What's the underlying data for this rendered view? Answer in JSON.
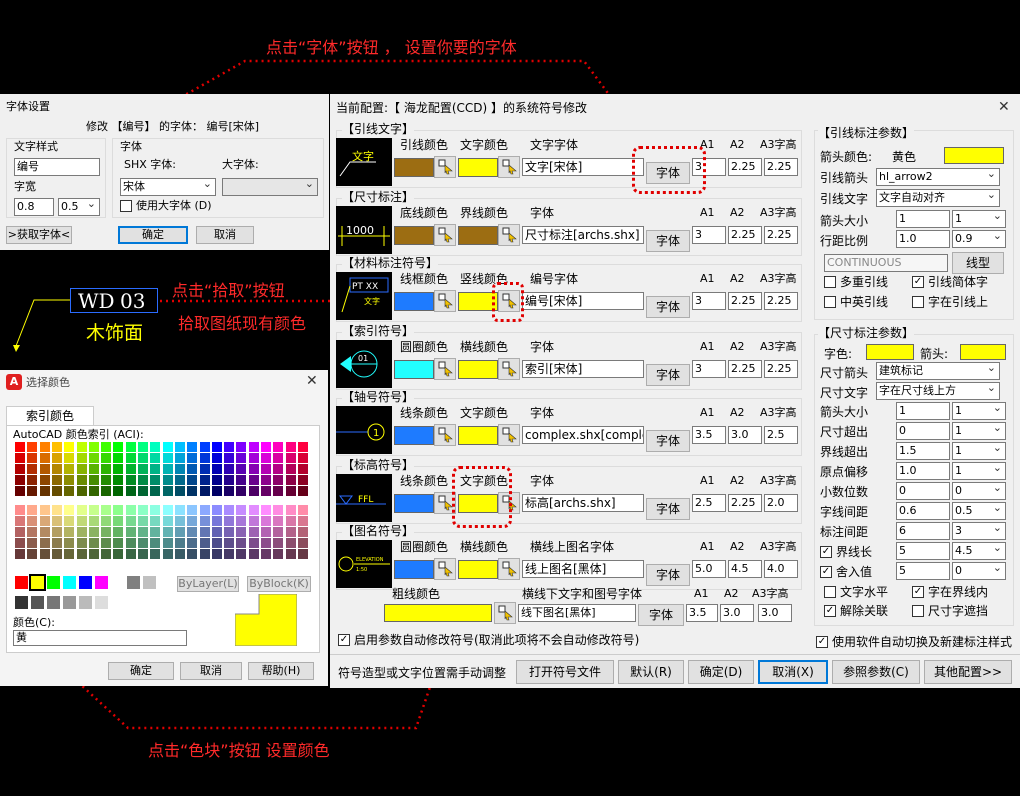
{
  "annotations": {
    "top": "点击“字体”按钮 ， 设置你要的字体",
    "pick1": "点击“拾取”按钮",
    "pick2": "拾取图纸现有颜色",
    "bottom": "点击“色块”按钮 设置颜色"
  },
  "sample": {
    "code": "WD",
    "num": "03",
    "text": "木饰面"
  },
  "font_dialog": {
    "title": "字体设置",
    "subtitle": "修改 【编号】 的字体： 编号[宋体]",
    "group_style": "文字样式",
    "style_value": "编号",
    "width_label": "字宽",
    "width_value": "0.8",
    "width_select": "0.5",
    "group_font": "字体",
    "shx_label": "SHX 字体:",
    "big_label": "大字体:",
    "shx_value": "宋体",
    "big_value": "",
    "use_big": "使用大字体 (D)",
    "get_font": ">获取字体<",
    "ok": "确定",
    "cancel": "取消"
  },
  "color_dialog": {
    "title": "选择颜色",
    "tab": "索引颜色",
    "aci_label": "AutoCAD 颜色索引 (ACI):",
    "bylayer": "ByLayer(L)",
    "byblock": "ByBlock(K)",
    "color_label": "颜色(C):",
    "color_value": "黄",
    "ok": "确定",
    "cancel": "取消",
    "help": "帮助(H)"
  },
  "main": {
    "title": "当前配置:【 海龙配置(CCD) 】的系统符号修改",
    "sections": [
      {
        "title": "【引线文字】",
        "c1": "引线颜色",
        "c2": "文字颜色",
        "fl": "文字字体",
        "font": "文字[宋体]",
        "a1": "3",
        "a2": "2.25",
        "a3": "2.25",
        "preview": "文字"
      },
      {
        "title": "【尺寸标注】",
        "c1": "底线颜色",
        "c2": "界线颜色",
        "fl": "字体",
        "font": "尺寸标注[archs.shx]",
        "a1": "3",
        "a2": "2.25",
        "a3": "2.25",
        "preview": "1000"
      },
      {
        "title": "【材料标注符号】",
        "c1": "线框颜色",
        "c2": "竖线颜色",
        "fl": "编号字体",
        "font": "编号[宋体]",
        "a1": "3",
        "a2": "2.25",
        "a3": "2.25",
        "preview": "PT XX"
      },
      {
        "title": "【索引符号】",
        "c1": "圆圈颜色",
        "c2": "横线颜色",
        "fl": "字体",
        "font": "索引[宋体]",
        "a1": "3",
        "a2": "2.25",
        "a3": "2.25",
        "preview": "01"
      },
      {
        "title": "【轴号符号】",
        "c1": "线条颜色",
        "c2": "文字颜色",
        "fl": "字体",
        "font": "complex.shx[complex.",
        "a1": "3.5",
        "a2": "3.0",
        "a3": "2.5",
        "preview": "1"
      },
      {
        "title": "【标高符号】",
        "c1": "线条颜色",
        "c2": "文字颜色",
        "fl": "字体",
        "font": "标高[archs.shx]",
        "a1": "2.5",
        "a2": "2.25",
        "a3": "2.0",
        "preview": "FFL"
      },
      {
        "title": "【图名符号】",
        "c1": "圆圈颜色",
        "c2": "横线颜色",
        "fl": "横线上图名字体",
        "font": "线上图名[黑体]",
        "a1": "5.0",
        "a2": "4.5",
        "a3": "4.0",
        "preview": "ELEVATION"
      }
    ],
    "col_a1": "A1",
    "col_a2": "A2",
    "col_a3": "A3字高",
    "font_btn": "字体",
    "extra": {
      "label": "粗线颜色",
      "fl": "横线下文字和图号字体",
      "font": "线下图名[黑体]",
      "a1": "3.5",
      "a2": "3.0",
      "a3": "3.0"
    },
    "leader": {
      "title": "【引线标注参数】",
      "arrow_color": "箭头颜色:",
      "arrow_color_value": "黄色",
      "arrow": "引线箭头",
      "arrow_value": "hl_arrow2",
      "text": "引线文字",
      "text_value": "文字自动对齐",
      "size": "箭头大小",
      "size_value": "1",
      "size_sel": "1",
      "ratio": "行距比例",
      "ratio_value": "1.0",
      "ratio_sel": "0.9",
      "linetype": "CONTINUOUS",
      "linetype_btn": "线型",
      "cb1": "多重引线",
      "cb2": "引线简体字",
      "cb3": "中英引线",
      "cb4": "字在引线上"
    },
    "dim": {
      "title": "【尺寸标注参数】",
      "text_color": "字色:",
      "arrow_color": "箭头:",
      "arrow": "尺寸箭头",
      "arrow_value": "建筑标记",
      "text": "尺寸文字",
      "text_value": "字在尺寸线上方",
      "rows": [
        {
          "l": "箭头大小",
          "v": "1",
          "s": "1"
        },
        {
          "l": "尺寸超出",
          "v": "0",
          "s": "1"
        },
        {
          "l": "界线超出",
          "v": "1.5",
          "s": "1"
        },
        {
          "l": "原点偏移",
          "v": "1.0",
          "s": "1"
        },
        {
          "l": "小数位数",
          "v": "0",
          "s": "0"
        },
        {
          "l": "字线间距",
          "v": "0.6",
          "s": "0.5"
        },
        {
          "l": "标注间距",
          "v": "6",
          "s": "3"
        },
        {
          "l": "界线长",
          "v": "5",
          "s": "4.5"
        },
        {
          "l": "舍入值",
          "v": "5",
          "s": "0"
        }
      ],
      "cb1": "文字水平",
      "cb2": "字在界线内",
      "cb3": "解除关联",
      "cb4": "尺寸字遮挡"
    },
    "auto_modify": "启用参数自动修改符号(取消此项将不会自动修改符号)",
    "auto_switch": "使用软件自动切换及新建标注样式",
    "bottom_text": "符号造型或文字位置需手动调整",
    "buttons": {
      "open": "打开符号文件",
      "default": "默认(R)",
      "ok": "确定(D)",
      "cancel": "取消(X)",
      "ref": "参照参数(C)",
      "other": "其他配置>>"
    }
  },
  "colors": {
    "yellow": "#ffff00",
    "blue": "#1e7bff",
    "brown": "#9c6d12",
    "cyan": "#22ffff",
    "annotation": "#ff2a2a"
  }
}
